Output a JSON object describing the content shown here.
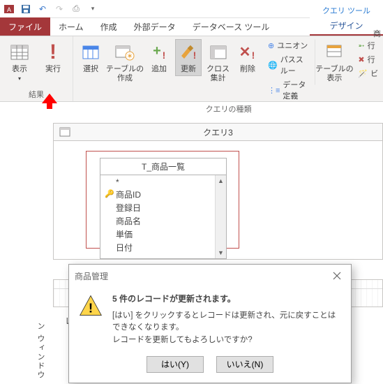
{
  "qat": {
    "app": "Access"
  },
  "tabs": {
    "file": "ファイル",
    "home": "ホーム",
    "create": "作成",
    "external": "外部データ",
    "dbtools": "データベース ツール",
    "context_title": "クエリ ツール",
    "design": "デザイン"
  },
  "ribbon": {
    "results_group": "結果",
    "view": "表示",
    "run": "実行",
    "querytype_group": "クエリの種類",
    "select": "選択",
    "maketable": "テーブルの\n作成",
    "append": "追加",
    "update": "更新",
    "crosstab": "クロス\n集計",
    "delete": "削除",
    "union": "ユニオン",
    "passthrough": "パススルー",
    "datadef": "データ定義",
    "table_show": "テーブルの\n表示",
    "row_ins": "行",
    "row_del": "行",
    "builder": "ビ"
  },
  "document": {
    "tab_title": "クエリ3",
    "table_name": "T_商品一覧",
    "fields": {
      "star": "*",
      "f1": "商品ID",
      "f2": "登録日",
      "f3": "商品名",
      "f4": "単価",
      "f5": "日付"
    },
    "row_label": "レ"
  },
  "side_label": "ン ウィンドウ",
  "truncated": "商",
  "dialog": {
    "title": "商品管理",
    "headline": "5 件のレコードが更新されます。",
    "line1": "[はい] をクリックするとレコードは更新され、元に戻すことはできなくなります。",
    "line2": "レコードを更新してもよろしいですか?",
    "yes": "はい(Y)",
    "no": "いいえ(N)"
  }
}
